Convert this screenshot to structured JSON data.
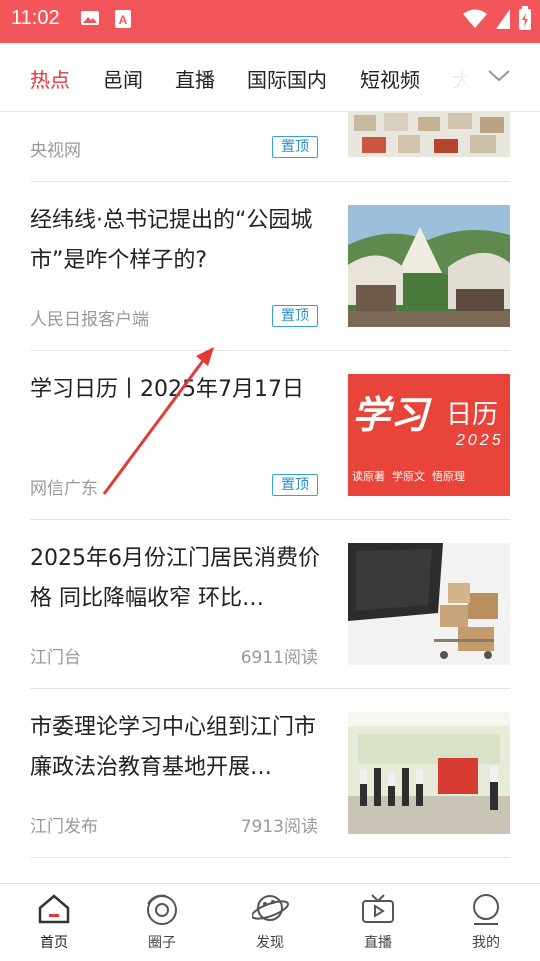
{
  "status_bar": {
    "time": "11:02"
  },
  "tabs": [
    {
      "label": "热点",
      "active": true
    },
    {
      "label": "邑闻"
    },
    {
      "label": "直播"
    },
    {
      "label": "国际国内"
    },
    {
      "label": "短视频"
    },
    {
      "label": "大"
    }
  ],
  "feed": [
    {
      "title": "",
      "source": "央视网",
      "badge": "置顶"
    },
    {
      "title": "经纬线·总书记提出的“公园城市”是咋个样子的?",
      "source": "人民日报客户端",
      "badge": "置顶"
    },
    {
      "title": "学习日历丨2025年7月17日",
      "source": "网信广东",
      "badge": "置顶",
      "image_text": {
        "main": "学习",
        "sub": "日历",
        "year": "2025",
        "footer": "读原著  学原文  悟原理"
      }
    },
    {
      "title": "2025年6月份江门居民消费价格 同比降幅收窄 环比…",
      "source": "江门台",
      "reads": "6911阅读"
    },
    {
      "title": "市委理论学习中心组到江门市廉政法治教育基地开展…",
      "source": "江门发布",
      "reads": "7913阅读"
    }
  ],
  "bottom_nav": [
    {
      "label": "首页",
      "icon": "home-icon",
      "active": true
    },
    {
      "label": "圈子",
      "icon": "circle-target-icon"
    },
    {
      "label": "发现",
      "icon": "planet-icon"
    },
    {
      "label": "直播",
      "icon": "tv-icon"
    },
    {
      "label": "我的",
      "icon": "profile-icon"
    }
  ],
  "colors": {
    "brand_red": "#f2565a",
    "active_tab": "#e8343a",
    "badge_blue": "#2a8fc9"
  }
}
